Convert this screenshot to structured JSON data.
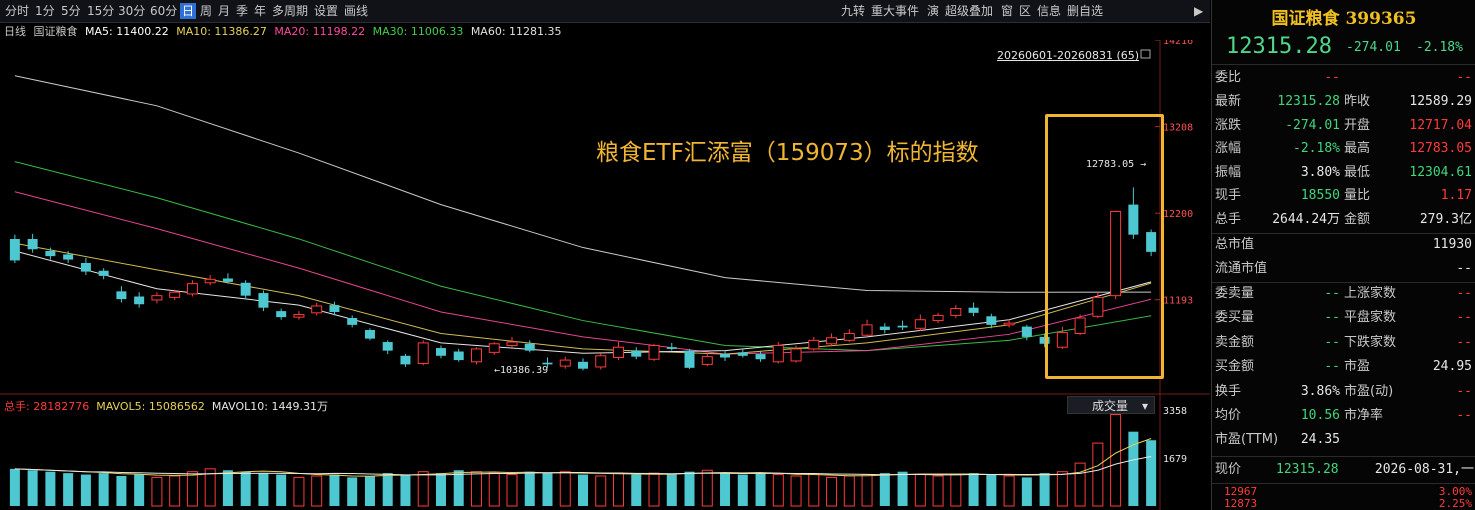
{
  "toolbar": {
    "items": [
      "分时",
      "1分",
      "5分",
      "15分",
      "30分",
      "60分",
      "日",
      "周",
      "月",
      "季",
      "年",
      "多周期",
      "设置",
      "画线"
    ],
    "active_index": 6,
    "right_items": [
      "九转",
      "重大事件",
      "演",
      "超级叠加",
      "窗",
      "区",
      "信息",
      "删自选"
    ]
  },
  "legend": {
    "period": "日线",
    "name": "国证粮食",
    "ma5": "MA5: 11400.22",
    "ma10": "MA10: 11386.27",
    "ma20": "MA20: 11198.22",
    "ma30": "MA30: 11006.33",
    "ma60": "MA60: 11281.35"
  },
  "colors": {
    "ma5": "#ffffff",
    "ma10": "#e6d15a",
    "ma20": "#ff4aa0",
    "ma30": "#3fcf4a",
    "ma60": "#e0e0e0",
    "up": "#ff3a3a",
    "down": "#4ec8d0",
    "accent": "#f0b531"
  },
  "range_label": "20260601-20260831 (65)",
  "annotation": "粮食ETF汇添富（159073）标的指数",
  "price_axis": [
    "14216",
    "13208",
    "12200",
    "11193"
  ],
  "volume_axis": [
    "3358",
    "1679"
  ],
  "high_marker": "12783.05",
  "low_marker": "10386.39",
  "volume_legend": {
    "total": "总手: 28182776",
    "mavol5": "MAVOL5: 15086562",
    "mavol10": "MAVOL10: 1449.31万"
  },
  "volume_selector": "成交量",
  "chart_data": {
    "type": "candlestick",
    "ylim": [
      10200,
      14216
    ],
    "candles": [
      [
        11900,
        11650,
        11950,
        11620
      ],
      [
        11900,
        11780,
        11960,
        11740
      ],
      [
        11760,
        11700,
        11800,
        11660
      ],
      [
        11720,
        11660,
        11760,
        11620
      ],
      [
        11620,
        11520,
        11680,
        11480
      ],
      [
        11530,
        11470,
        11560,
        11430
      ],
      [
        11290,
        11200,
        11350,
        11160
      ],
      [
        11230,
        11140,
        11280,
        11100
      ],
      [
        11190,
        11240,
        11280,
        11150
      ],
      [
        11220,
        11280,
        11310,
        11190
      ],
      [
        11260,
        11380,
        11420,
        11230
      ],
      [
        11390,
        11430,
        11480,
        11360
      ],
      [
        11440,
        11400,
        11500,
        11380
      ],
      [
        11390,
        11240,
        11420,
        11200
      ],
      [
        11270,
        11100,
        11300,
        11060
      ],
      [
        11060,
        10990,
        11090,
        10960
      ],
      [
        10990,
        11020,
        11060,
        10960
      ],
      [
        11040,
        11120,
        11160,
        11010
      ],
      [
        11130,
        11050,
        11170,
        11010
      ],
      [
        10980,
        10900,
        11010,
        10870
      ],
      [
        10840,
        10740,
        10860,
        10720
      ],
      [
        10700,
        10600,
        10720,
        10560
      ],
      [
        10540,
        10440,
        10560,
        10410
      ],
      [
        10450,
        10690,
        10720,
        10430
      ],
      [
        10630,
        10540,
        10660,
        10510
      ],
      [
        10590,
        10490,
        10620,
        10470
      ],
      [
        10470,
        10620,
        10640,
        10440
      ],
      [
        10580,
        10680,
        10700,
        10550
      ],
      [
        10660,
        10700,
        10760,
        10640
      ],
      [
        10680,
        10600,
        10720,
        10580
      ],
      [
        10460,
        10440,
        10520,
        10400
      ],
      [
        10420,
        10490,
        10530,
        10390
      ],
      [
        10470,
        10390,
        10510,
        10370
      ],
      [
        10410,
        10540,
        10570,
        10380
      ],
      [
        10520,
        10640,
        10700,
        10490
      ],
      [
        10600,
        10530,
        10640,
        10500
      ],
      [
        10500,
        10660,
        10680,
        10480
      ],
      [
        10640,
        10620,
        10690,
        10600
      ],
      [
        10600,
        10400,
        10620,
        10386
      ],
      [
        10440,
        10530,
        10570,
        10420
      ],
      [
        10560,
        10520,
        10600,
        10480
      ],
      [
        10580,
        10540,
        10620,
        10520
      ],
      [
        10560,
        10500,
        10600,
        10470
      ],
      [
        10470,
        10660,
        10700,
        10450
      ],
      [
        10480,
        10620,
        10660,
        10460
      ],
      [
        10620,
        10720,
        10760,
        10600
      ],
      [
        10680,
        10750,
        10800,
        10650
      ],
      [
        10720,
        10800,
        10850,
        10700
      ],
      [
        10780,
        10900,
        10960,
        10760
      ],
      [
        10880,
        10840,
        10920,
        10800
      ],
      [
        10890,
        10870,
        10950,
        10840
      ],
      [
        10860,
        10960,
        11020,
        10830
      ],
      [
        10950,
        11010,
        11040,
        10920
      ],
      [
        11010,
        11090,
        11130,
        10980
      ],
      [
        11100,
        11040,
        11160,
        11000
      ],
      [
        11000,
        10900,
        11030,
        10860
      ],
      [
        10900,
        10920,
        10960,
        10870
      ],
      [
        10880,
        10760,
        10900,
        10720
      ],
      [
        10760,
        10680,
        10800,
        10640
      ],
      [
        10640,
        10810,
        10880,
        10620
      ],
      [
        10800,
        10980,
        11020,
        10780
      ],
      [
        11000,
        11220,
        11280,
        10980
      ],
      [
        11240,
        12220,
        12230,
        11200
      ],
      [
        12300,
        11950,
        12500,
        11900
      ],
      [
        11980,
        11750,
        12010,
        11700
      ]
    ],
    "volume": [
      1300,
      1250,
      1200,
      1150,
      1100,
      1150,
      1050,
      1100,
      1000,
      1050,
      1200,
      1300,
      1250,
      1200,
      1150,
      1100,
      1000,
      1050,
      1100,
      1000,
      1050,
      1150,
      1100,
      1200,
      1150,
      1250,
      1200,
      1150,
      1100,
      1200,
      1150,
      1200,
      1100,
      1050,
      1150,
      1100,
      1150,
      1100,
      1200,
      1250,
      1150,
      1100,
      1150,
      1100,
      1050,
      1100,
      1000,
      1050,
      1100,
      1150,
      1200,
      1100,
      1050,
      1100,
      1150,
      1100,
      1050,
      1000,
      1150,
      1200,
      1500,
      2200,
      3200,
      2600,
      2300
    ],
    "ma_lines": {
      "ma5": [
        [
          0,
          11760
        ],
        [
          8,
          11320
        ],
        [
          16,
          11130
        ],
        [
          24,
          10690
        ],
        [
          32,
          10570
        ],
        [
          40,
          10600
        ],
        [
          48,
          10760
        ],
        [
          56,
          10960
        ],
        [
          64,
          11400
        ]
      ],
      "ma10": [
        [
          0,
          11850
        ],
        [
          8,
          11540
        ],
        [
          16,
          11240
        ],
        [
          24,
          10800
        ],
        [
          32,
          10620
        ],
        [
          40,
          10560
        ],
        [
          48,
          10690
        ],
        [
          56,
          10900
        ],
        [
          64,
          11386
        ]
      ],
      "ma20": [
        [
          0,
          12450
        ],
        [
          8,
          12020
        ],
        [
          16,
          11560
        ],
        [
          24,
          11050
        ],
        [
          32,
          10760
        ],
        [
          40,
          10560
        ],
        [
          48,
          10600
        ],
        [
          56,
          10790
        ],
        [
          64,
          11198
        ]
      ],
      "ma30": [
        [
          0,
          12800
        ],
        [
          8,
          12380
        ],
        [
          16,
          11900
        ],
        [
          24,
          11350
        ],
        [
          32,
          10950
        ],
        [
          40,
          10660
        ],
        [
          48,
          10600
        ],
        [
          56,
          10720
        ],
        [
          64,
          11006
        ]
      ],
      "ma60": [
        [
          0,
          13800
        ],
        [
          8,
          13450
        ],
        [
          16,
          12900
        ],
        [
          24,
          12300
        ],
        [
          32,
          11800
        ],
        [
          40,
          11450
        ],
        [
          48,
          11300
        ],
        [
          56,
          11280
        ],
        [
          64,
          11281
        ]
      ]
    }
  },
  "quote": {
    "title": "国证粮食 399365",
    "price": "12315.28",
    "change": "-274.01",
    "pct": "-2.18%",
    "rows": [
      {
        "l": "委比",
        "v": "--",
        "l2": "",
        "v2": "--"
      },
      {
        "l": "最新",
        "v": "12315.28",
        "l2": "昨收",
        "v2": "12589.29"
      },
      {
        "l": "涨跌",
        "v": "-274.01",
        "l2": "开盘",
        "v2": "12717.04"
      },
      {
        "l": "涨幅",
        "v": "-2.18%",
        "l2": "最高",
        "v2": "12783.05"
      },
      {
        "l": "振幅",
        "v": "3.80%",
        "l2": "最低",
        "v2": "12304.61"
      },
      {
        "l": "现手",
        "v": "18550",
        "l2": "量比",
        "v2": "1.17"
      },
      {
        "l": "总手",
        "v": "2644.24万",
        "l2": "金额",
        "v2": "279.3亿"
      }
    ],
    "mcap_rows": [
      {
        "l": "总市值",
        "v": "11930"
      },
      {
        "l": "流通市值",
        "v": "--"
      }
    ],
    "order_rows": [
      {
        "l": "委卖量",
        "v": "--",
        "l2": "上涨家数",
        "v2": "--"
      },
      {
        "l": "委买量",
        "v": "--",
        "l2": "平盘家数",
        "v2": "--"
      },
      {
        "l": "卖金额",
        "v": "--",
        "l2": "下跌家数",
        "v2": "--"
      },
      {
        "l": "买金额",
        "v": "--",
        "l2": "市盈",
        "v2": "24.95"
      },
      {
        "l": "换手",
        "v": "3.86%",
        "l2": "市盈(动)",
        "v2": "--"
      },
      {
        "l": "均价",
        "v": "10.56",
        "l2": "市净率",
        "v2": "--"
      },
      {
        "l": "市盈(TTM)",
        "v": "24.35",
        "l2": "",
        "v2": ""
      }
    ],
    "now_label": "现价",
    "now_value": "12315.28",
    "now_date": "2026-08-31,一",
    "ticks": [
      {
        "p": "12967",
        "pct": "3.00%"
      },
      {
        "p": "12873",
        "pct": "2.25%"
      }
    ]
  }
}
